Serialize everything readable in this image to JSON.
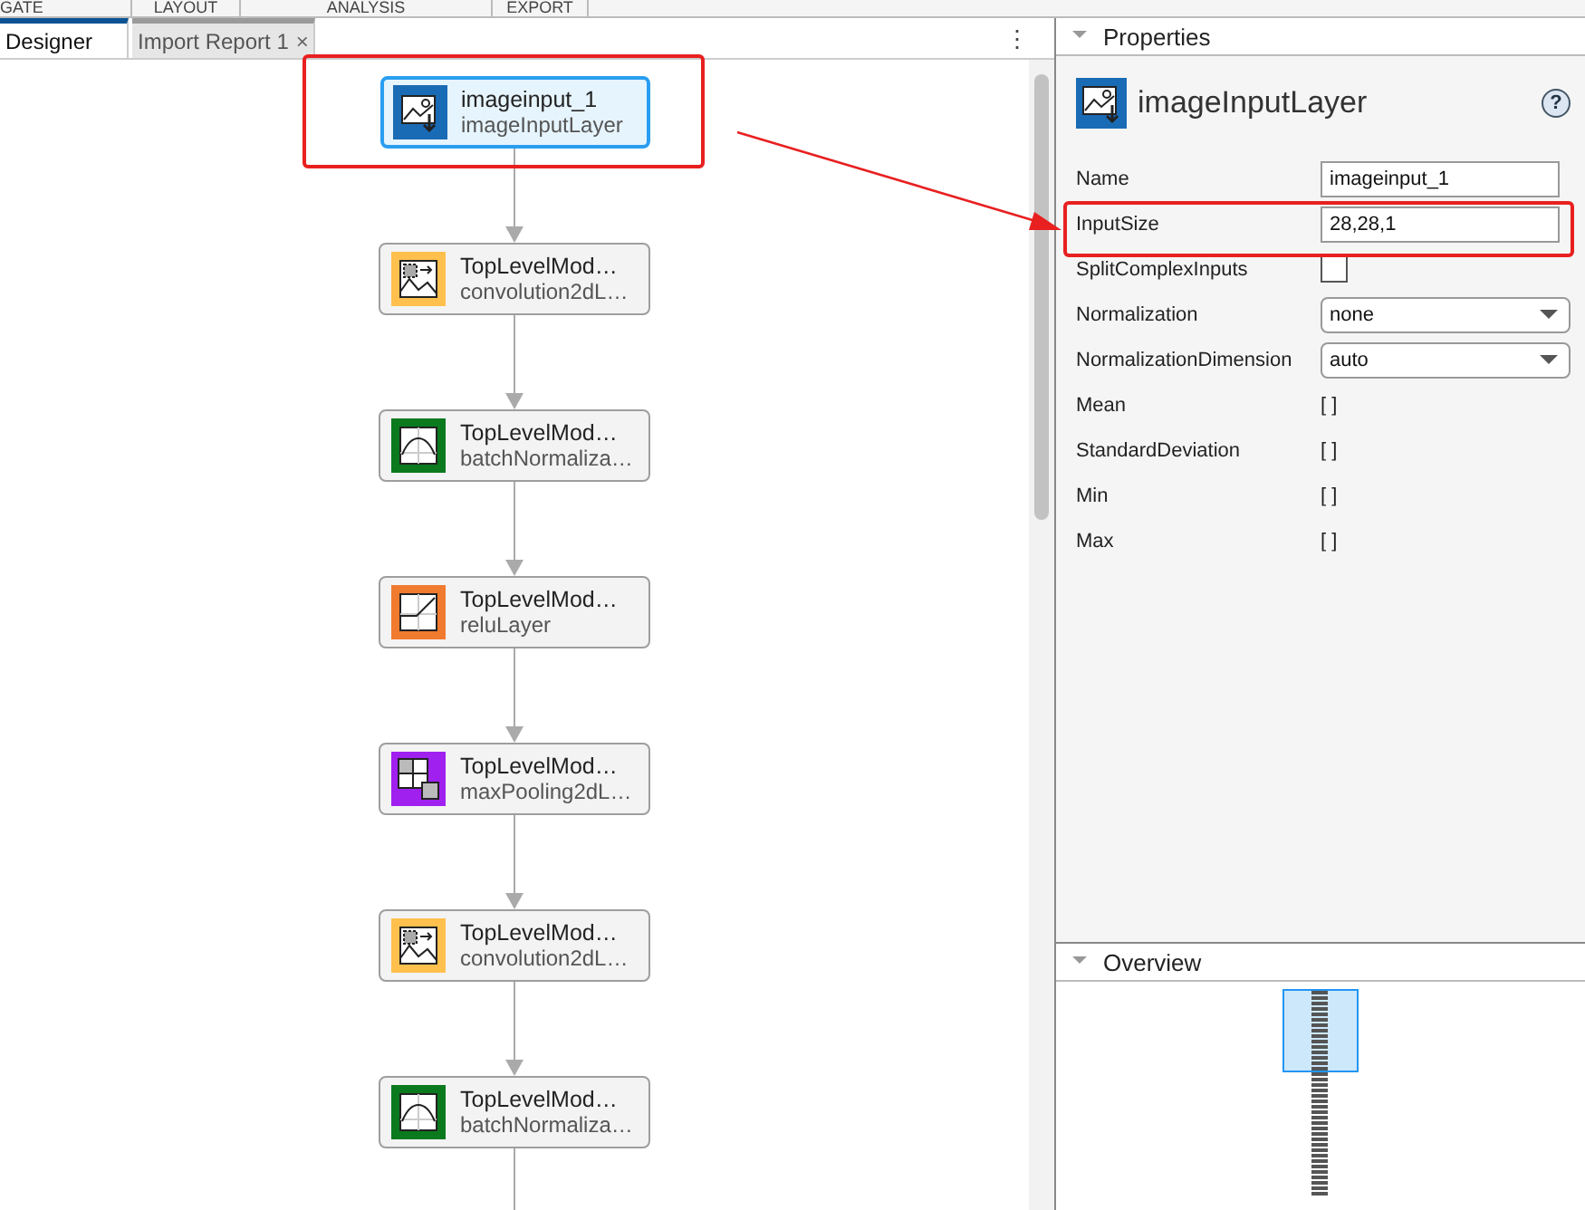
{
  "toolstrip_tabs": [
    {
      "label": "GATE"
    },
    {
      "label": "LAYOUT"
    },
    {
      "label": "ANALYSIS"
    },
    {
      "label": "EXPORT"
    }
  ],
  "document_tabs": [
    {
      "label": "Designer",
      "selected": true,
      "closable": false
    },
    {
      "label": "Import Report 1",
      "selected": false,
      "closable": true,
      "close_glyph": "×"
    }
  ],
  "canvas_menu": "⋮",
  "layers": [
    {
      "kind": "input",
      "name": "imageinput_1",
      "type": "imageInputLayer",
      "selected": true
    },
    {
      "kind": "conv",
      "name": "TopLevelMod…",
      "type": "convolution2dL…",
      "selected": false
    },
    {
      "kind": "batchnorm",
      "name": "TopLevelMod…",
      "type": "batchNormaliza…",
      "selected": false
    },
    {
      "kind": "relu",
      "name": "TopLevelMod…",
      "type": "reluLayer",
      "selected": false
    },
    {
      "kind": "maxpool",
      "name": "TopLevelMod…",
      "type": "maxPooling2dL…",
      "selected": false
    },
    {
      "kind": "conv",
      "name": "TopLevelMod…",
      "type": "convolution2dL…",
      "selected": false
    },
    {
      "kind": "batchnorm",
      "name": "TopLevelMod…",
      "type": "batchNormaliza…",
      "selected": false
    }
  ],
  "properties": {
    "title": "Properties",
    "expanded": true,
    "layer_type": "imageInputLayer",
    "help": "?",
    "rows": [
      {
        "kind": "text",
        "label": "Name",
        "value": "imageinput_1"
      },
      {
        "kind": "text",
        "label": "InputSize",
        "value": "28,28,1"
      },
      {
        "kind": "checkbox",
        "label": "SplitComplexInputs",
        "checked": false
      },
      {
        "kind": "dropdown",
        "label": "Normalization",
        "value": "none"
      },
      {
        "kind": "dropdown",
        "label": "NormalizationDimension",
        "value": "auto"
      },
      {
        "kind": "static",
        "label": "Mean",
        "value": "[ ]"
      },
      {
        "kind": "static",
        "label": "StandardDeviation",
        "value": "[ ]"
      },
      {
        "kind": "static",
        "label": "Min",
        "value": "[ ]"
      },
      {
        "kind": "static",
        "label": "Max",
        "value": "[ ]"
      }
    ]
  },
  "overview": {
    "title": "Overview",
    "expanded": true
  }
}
